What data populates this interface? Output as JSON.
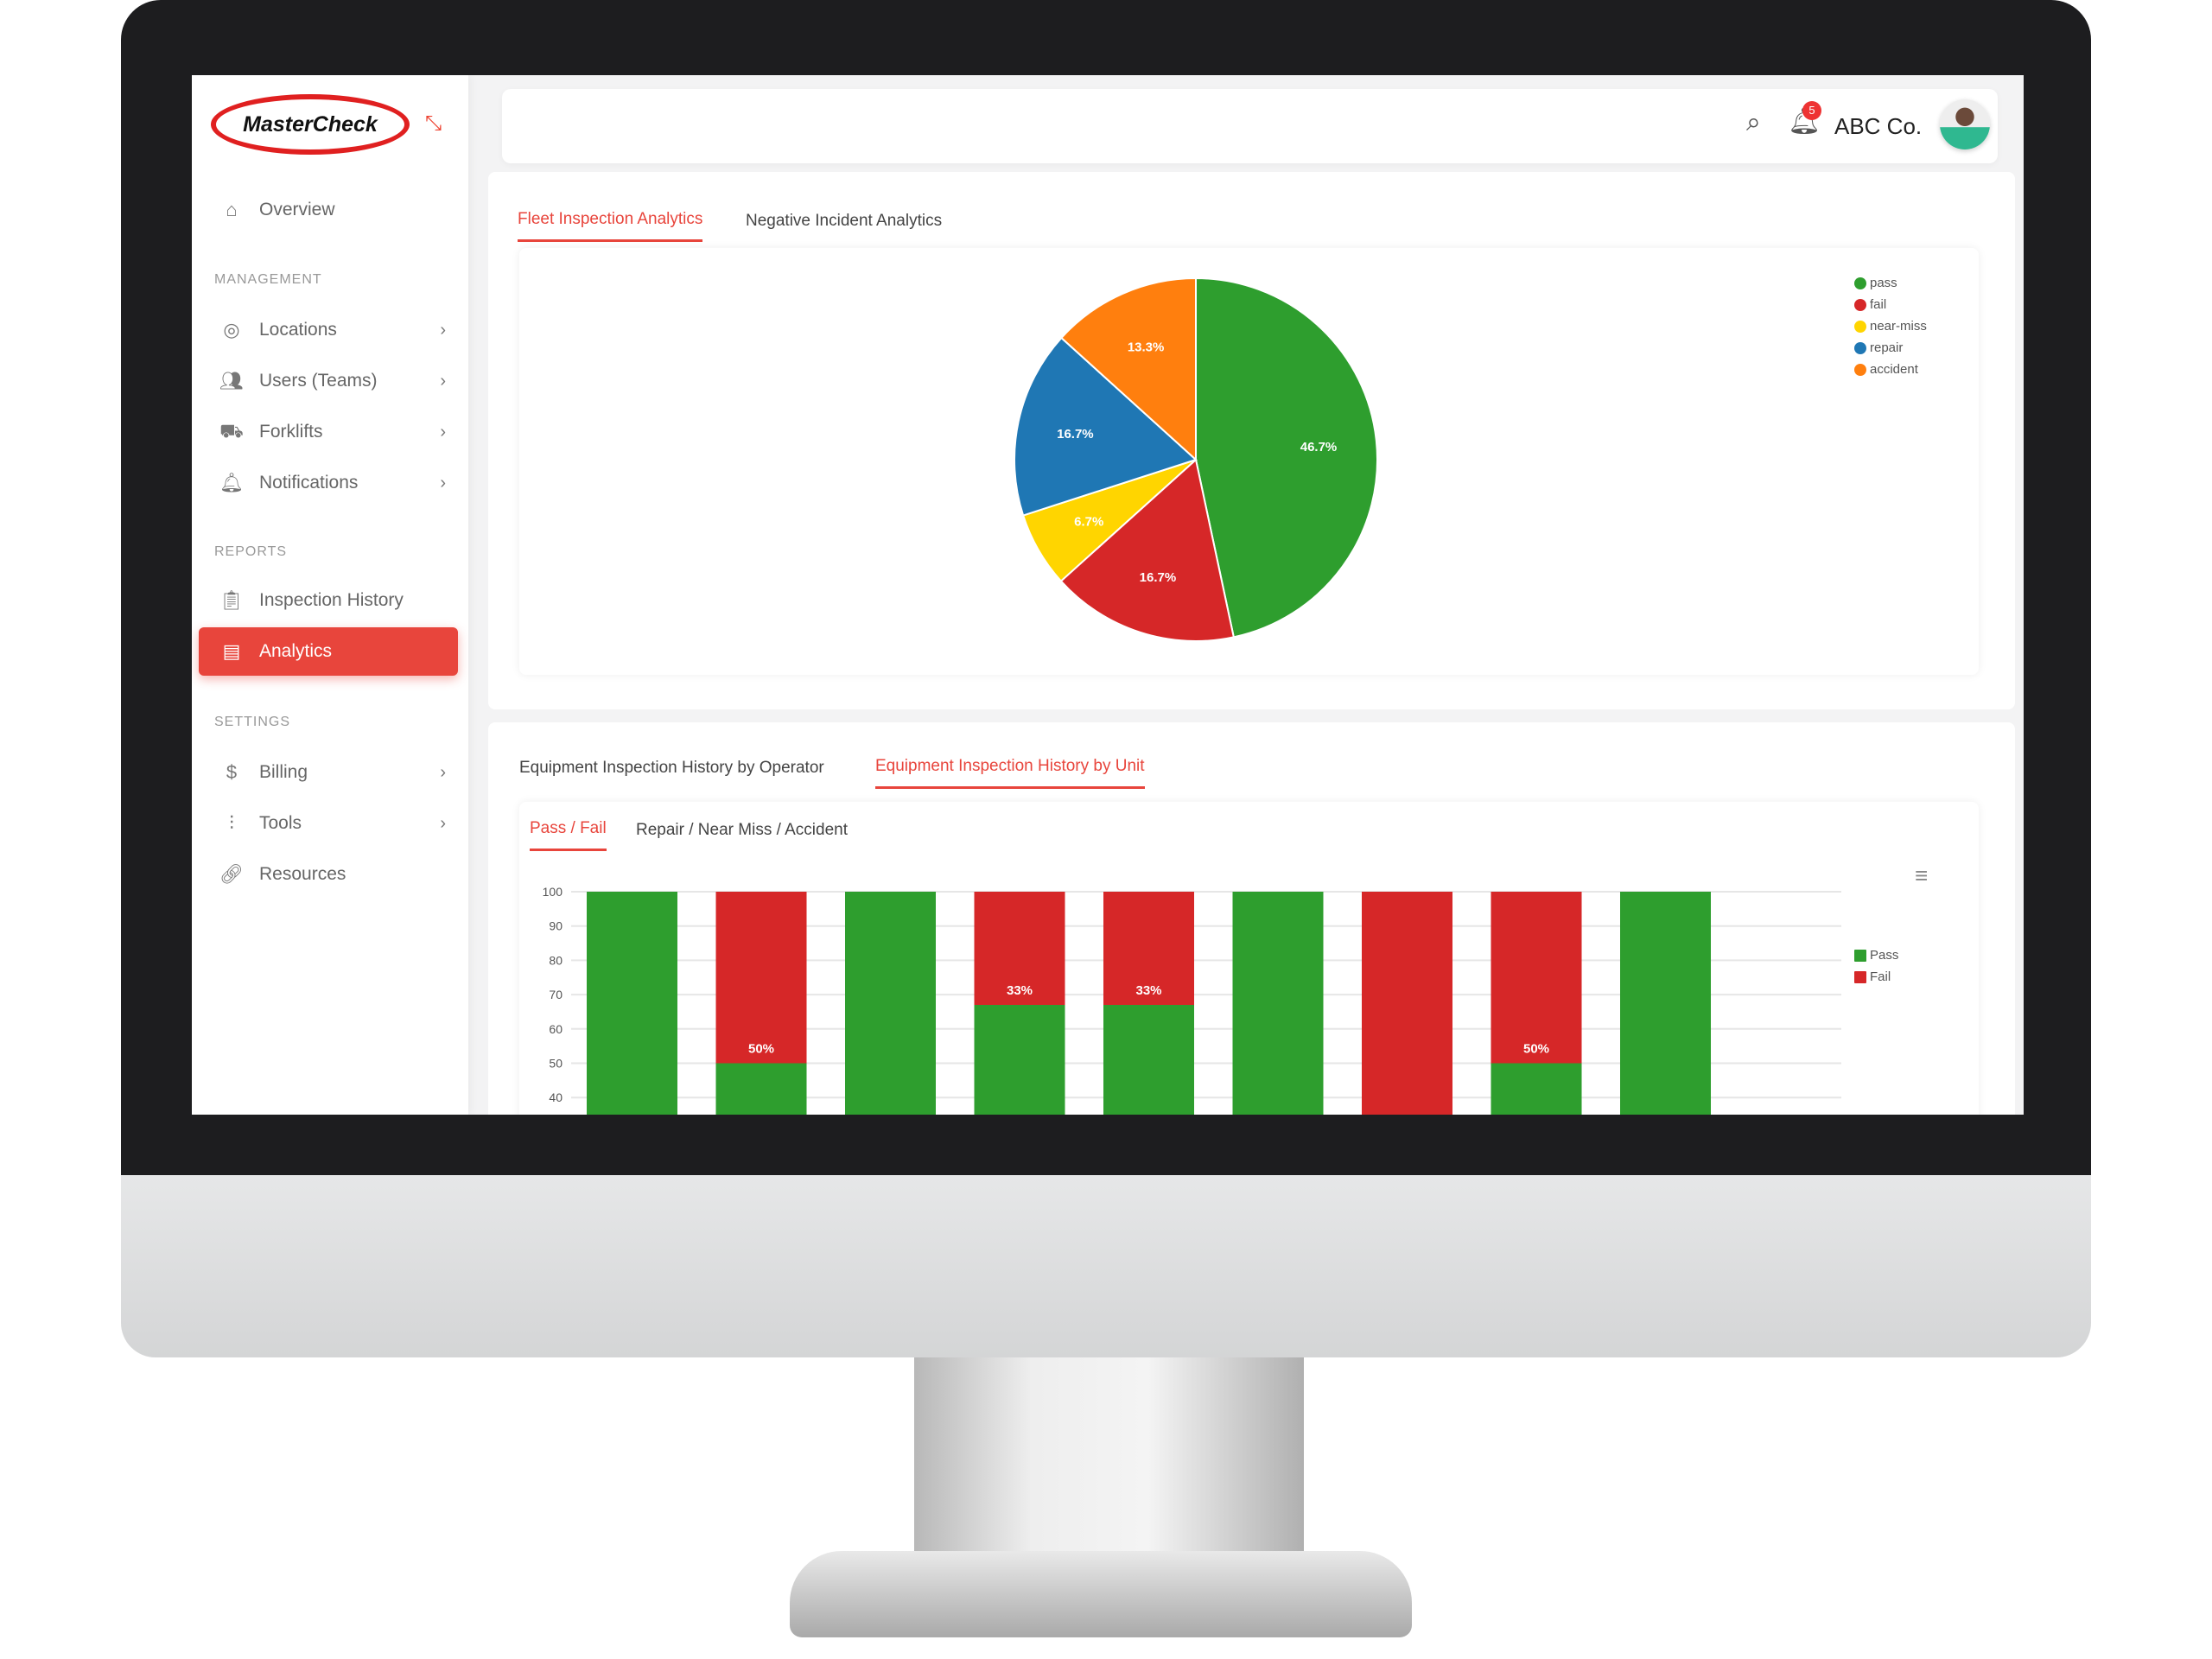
{
  "logo": "MasterCheck",
  "sidebar": {
    "overview": "Overview",
    "sections": {
      "management": "MANAGEMENT",
      "reports": "REPORTS",
      "settings": "SETTINGS"
    },
    "items": [
      {
        "label": "Locations"
      },
      {
        "label": "Users (Teams)"
      },
      {
        "label": "Forklifts"
      },
      {
        "label": "Notifications"
      },
      {
        "label": "Inspection History"
      },
      {
        "label": "Analytics"
      },
      {
        "label": "Billing"
      },
      {
        "label": "Tools"
      },
      {
        "label": "Resources"
      }
    ],
    "active": "Analytics"
  },
  "header": {
    "company": "ABC Co.",
    "notification_count": "5"
  },
  "top_tabs": [
    "Fleet Inspection Analytics",
    "Negative Incident Analytics"
  ],
  "bottom_tabs": [
    "Equipment Inspection History by Operator",
    "Equipment Inspection History by Unit"
  ],
  "sub_tabs": [
    "Pass / Fail",
    "Repair / Near Miss / Accident"
  ],
  "colors": {
    "accent": "#e8453c",
    "pass": "#2e9e2e",
    "fail": "#d62728",
    "near_miss": "#ffd500",
    "repair": "#1f77b4",
    "accident": "#ff7f0e"
  },
  "chart_data": [
    {
      "type": "pie",
      "legend_position": "top-right",
      "series": [
        {
          "name": "pass",
          "value": 46.7,
          "label": "46.7%",
          "color": "#2e9e2e"
        },
        {
          "name": "fail",
          "value": 16.7,
          "label": "16.7%",
          "color": "#d62728"
        },
        {
          "name": "near-miss",
          "value": 6.7,
          "label": "6.7%",
          "color": "#ffd500"
        },
        {
          "name": "repair",
          "value": 16.7,
          "label": "16.7%",
          "color": "#1f77b4"
        },
        {
          "name": "accident",
          "value": 13.3,
          "label": "13.3%",
          "color": "#ff7f0e"
        }
      ]
    },
    {
      "type": "bar",
      "stacked": true,
      "legend_position": "right",
      "grid": true,
      "ylim": [
        0,
        100
      ],
      "yticks": [
        40,
        50,
        60,
        70,
        80,
        90,
        100
      ],
      "series": [
        {
          "name": "Pass",
          "color": "#2e9e2e",
          "values": [
            100,
            50,
            100,
            67,
            67,
            100,
            0,
            50,
            100
          ]
        },
        {
          "name": "Fail",
          "color": "#d62728",
          "values": [
            0,
            50,
            0,
            33,
            33,
            0,
            100,
            50,
            0
          ],
          "labels": [
            "",
            "50%",
            "",
            "33%",
            "33%",
            "",
            "",
            "50%",
            ""
          ]
        }
      ]
    }
  ]
}
